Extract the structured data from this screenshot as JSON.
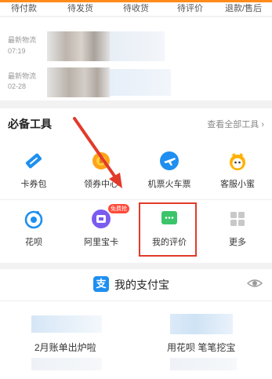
{
  "order_tabs": [
    "待付款",
    "待发货",
    "待收货",
    "待评价",
    "退款/售后"
  ],
  "logistics": [
    {
      "label": "最新物流",
      "time": "07:19"
    },
    {
      "label": "最新物流",
      "time": "02-28"
    }
  ],
  "tools": {
    "title": "必备工具",
    "view_all": "查看全部工具",
    "items": [
      {
        "label": "卡券包",
        "icon": "ticket-icon",
        "color": "#1e8ff0"
      },
      {
        "label": "领券中心",
        "icon": "coupon-icon",
        "color": "#ffa31a"
      },
      {
        "label": "机票火车票",
        "icon": "plane-icon",
        "color": "#1e8ff0"
      },
      {
        "label": "客服小蜜",
        "icon": "mascot-icon",
        "color": "#ffb000"
      },
      {
        "label": "花呗",
        "icon": "huabei-icon",
        "color": "#1e8ff0"
      },
      {
        "label": "阿里宝卡",
        "icon": "sim-card-icon",
        "color": "#7b5cf0",
        "badge": "免费抢"
      },
      {
        "label": "我的评价",
        "icon": "comment-icon",
        "color": "#3bc46a"
      },
      {
        "label": "更多",
        "icon": "more-grid-icon",
        "color": "#c8c8c8"
      }
    ]
  },
  "alipay": {
    "title": "我的支付宝",
    "cards": [
      "2月账单出炉啦",
      "用花呗 笔笔挖宝"
    ]
  },
  "colors": {
    "accent": "#ff8c1a",
    "highlight": "#e23a2b"
  }
}
